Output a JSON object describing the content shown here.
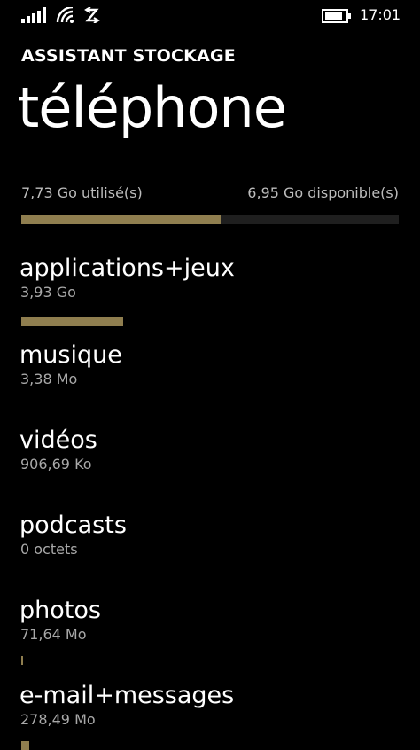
{
  "status_bar": {
    "time": "17:01",
    "icons": [
      "signal-strength-icon",
      "wifi-icon",
      "roaming-icon",
      "battery-icon"
    ]
  },
  "header": {
    "app_title": "ASSISTANT STOCKAGE",
    "page_title": "téléphone"
  },
  "usage": {
    "used_label": "7,73 Go utilisé(s)",
    "free_label": "6,95 Go disponible(s)",
    "used_fraction": 0.527
  },
  "categories": [
    {
      "name": "applications+jeux",
      "size": "3,93 Go",
      "bar_fraction": 0.27
    },
    {
      "name": "musique",
      "size": "3,38 Mo",
      "bar_fraction": 0
    },
    {
      "name": "vidéos",
      "size": "906,69 Ko",
      "bar_fraction": 0
    },
    {
      "name": "podcasts",
      "size": "0 octets",
      "bar_fraction": 0
    },
    {
      "name": "photos",
      "size": "71,64 Mo",
      "bar_fraction": 0.005
    },
    {
      "name": "e-mail+messages",
      "size": "278,49 Mo",
      "bar_fraction": 0.02
    }
  ],
  "colors": {
    "background": "#000000",
    "accent": "#8f7e4f",
    "track": "#1f1f1f",
    "secondary_text": "#a8a8a8"
  }
}
